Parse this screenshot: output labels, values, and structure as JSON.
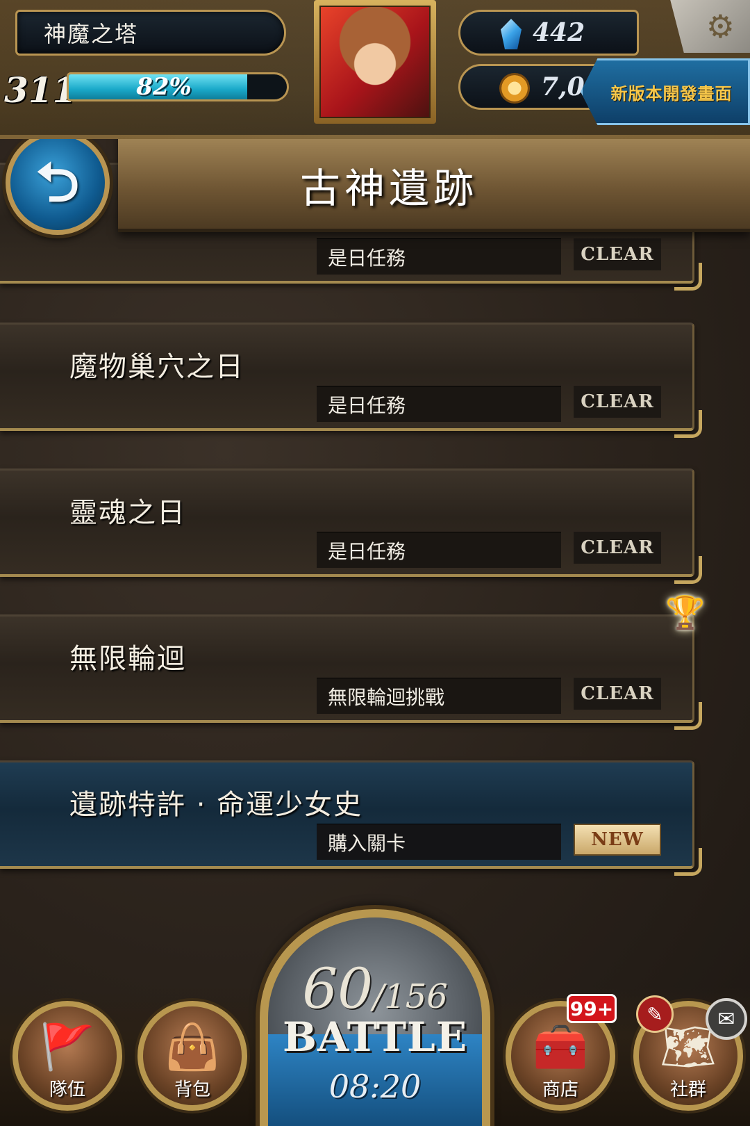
{
  "hud": {
    "game_title": "神魔之塔",
    "level": "311",
    "stamina_percent_label": "82%",
    "stamina_fraction": 0.82,
    "gems": "442",
    "coins": "7,0",
    "dev_banner": "新版本開發畫面"
  },
  "header": {
    "title": "古神遺跡"
  },
  "stages": [
    {
      "name": "",
      "sub": "是日任務",
      "status": "CLEAR"
    },
    {
      "name": "魔物巢穴之日",
      "sub": "是日任務",
      "status": "CLEAR"
    },
    {
      "name": "靈魂之日",
      "sub": "是日任務",
      "status": "CLEAR"
    },
    {
      "name": "無限輪迴",
      "sub": "無限輪迴挑戰",
      "status": "CLEAR"
    },
    {
      "name": "遺跡特許 · 命運少女史",
      "sub": "購入關卡",
      "status": "NEW"
    }
  ],
  "battle": {
    "current": "60",
    "max": "/156",
    "label": "BATTLE",
    "timer": "08:20"
  },
  "nav": {
    "team": "隊伍",
    "bag": "背包",
    "shop": "商店",
    "social": "社群",
    "shop_badge": "99+"
  },
  "icons": {
    "back": "arrow-back-icon",
    "settings": "gear-icon",
    "gem": "gem-icon",
    "coin": "coin-icon",
    "trophy": "trophy-icon",
    "team": "flag-icon",
    "bag": "bag-icon",
    "shop": "treasure-chest-icon",
    "social": "social-map-icon",
    "memo": "memo-icon",
    "mail": "mail-icon"
  },
  "colors": {
    "gold_frame": "#b99552",
    "stamina": "#1aa9c9",
    "dev_banner_text": "#f6c74a",
    "badge_red": "#d3151b"
  }
}
